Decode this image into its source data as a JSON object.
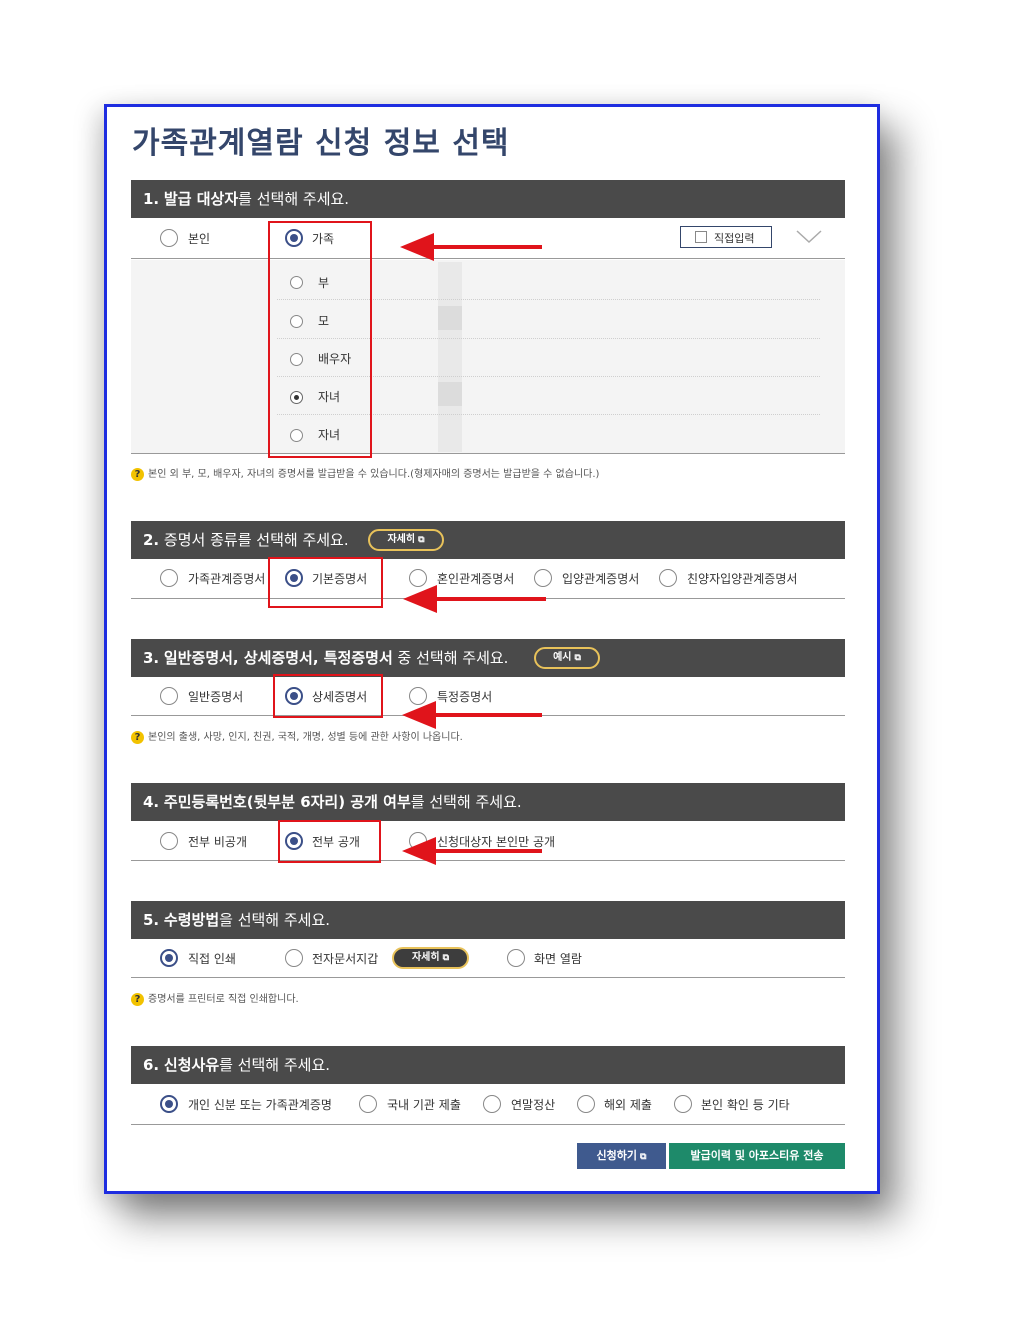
{
  "page_title": "가족관계열람 신청 정보 선택",
  "section1": {
    "num": "1.",
    "head_bold": "발급 대상자",
    "head_rest": "를 선택해 주세요.",
    "opt_self": "본인",
    "opt_family": "가족",
    "direct_input": "직접입력",
    "members": [
      "부",
      "모",
      "배우자",
      "자녀",
      "자녀"
    ],
    "help": "본인 외 부, 모, 배우자, 자녀의 증명서를 발급받을 수 있습니다.(형제자매의 증명서는 발급받을 수 없습니다.)"
  },
  "section2": {
    "num": "2.",
    "head_bold": "증명서 종류",
    "head_rest": "를 선택해 주세요.",
    "detail_btn": "자세히",
    "options": [
      "가족관계증명서",
      "기본증명서",
      "혼인관계증명서",
      "입양관계증명서",
      "친양자입양관계증명서"
    ]
  },
  "section3": {
    "num": "3.",
    "head_bold": "일반증명서, 상세증명서, 특정증명서",
    "head_rest": " 중 선택해 주세요.",
    "example_btn": "예시",
    "options": [
      "일반증명서",
      "상세증명서",
      "특정증명서"
    ],
    "help": "본인의 출생, 사망, 인지, 친권, 국적, 개명, 성별 등에 관한 사항이 나옵니다."
  },
  "section4": {
    "num": "4.",
    "head_bold": "주민등록번호(뒷부분 6자리) 공개 여부",
    "head_rest": "를 선택해 주세요.",
    "options": [
      "전부 비공개",
      "전부 공개",
      "신청대상자 본인만 공개"
    ]
  },
  "section5": {
    "num": "5.",
    "head_bold": "수령방법",
    "head_rest": "을 선택해 주세요.",
    "options": [
      "직접 인쇄",
      "전자문서지갑",
      "화면 열람"
    ],
    "detail_btn": "자세히",
    "help": "증명서를 프린터로 직접 인쇄합니다."
  },
  "section6": {
    "num": "6.",
    "head_bold": "신청사유",
    "head_rest": "를 선택해 주세요.",
    "options": [
      "개인 신분 또는 가족관계증명",
      "국내 기관 제출",
      "연말정산",
      "해외 제출",
      "본인 확인 등 기타"
    ]
  },
  "buttons": {
    "apply": "신청하기",
    "send": "발급이력 및 아포스티유 전송"
  },
  "colors": {
    "frame": "#1e2de0",
    "section_header": "#4a4a4a",
    "highlight": "#e0141b",
    "apply_button": "#3f5a8e",
    "send_button": "#1e8a6a"
  }
}
